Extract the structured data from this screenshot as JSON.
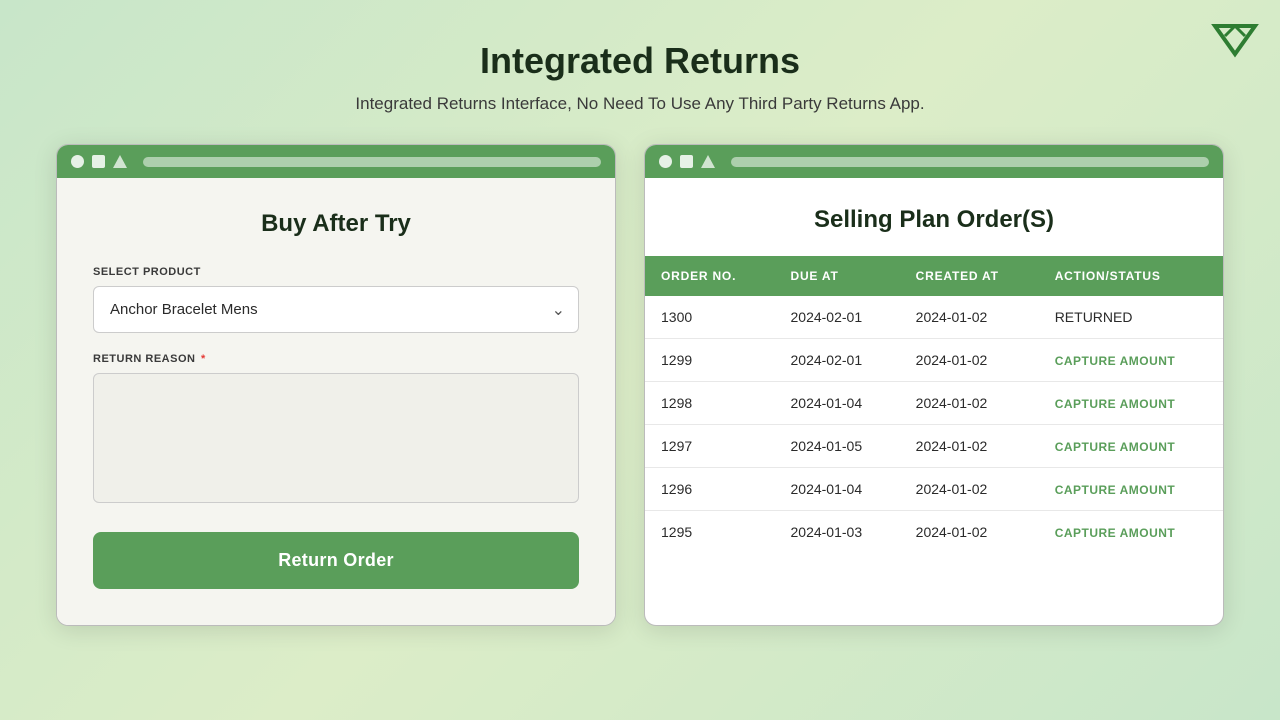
{
  "page": {
    "title": "Integrated Returns",
    "subtitle": "Integrated Returns Interface, No Need To Use Any Third Party Returns App."
  },
  "logo": {
    "alt": "App Logo"
  },
  "left_panel": {
    "title": "Buy After Try",
    "select_product_label": "SELECT PRODUCT",
    "selected_product": "Anchor Bracelet Mens",
    "return_reason_label": "RETURN REASON",
    "return_reason_required": true,
    "return_btn_label": "Return Order"
  },
  "right_panel": {
    "title": "Selling Plan Order(S)",
    "table": {
      "headers": [
        "ORDER NO.",
        "DUE AT",
        "CREATED AT",
        "ACTION/STATUS"
      ],
      "rows": [
        {
          "order_no": "1300",
          "due_at": "2024-02-01",
          "created_at": "2024-01-02",
          "action": "RETURNED",
          "is_returned": true
        },
        {
          "order_no": "1299",
          "due_at": "2024-02-01",
          "created_at": "2024-01-02",
          "action": "CAPTURE AMOUNT",
          "is_returned": false
        },
        {
          "order_no": "1298",
          "due_at": "2024-01-04",
          "created_at": "2024-01-02",
          "action": "CAPTURE AMOUNT",
          "is_returned": false
        },
        {
          "order_no": "1297",
          "due_at": "2024-01-05",
          "created_at": "2024-01-02",
          "action": "CAPTURE AMOUNT",
          "is_returned": false
        },
        {
          "order_no": "1296",
          "due_at": "2024-01-04",
          "created_at": "2024-01-02",
          "action": "CAPTURE AMOUNT",
          "is_returned": false
        },
        {
          "order_no": "1295",
          "due_at": "2024-01-03",
          "created_at": "2024-01-02",
          "action": "CAPTURE AMOUNT",
          "is_returned": false
        }
      ]
    }
  }
}
